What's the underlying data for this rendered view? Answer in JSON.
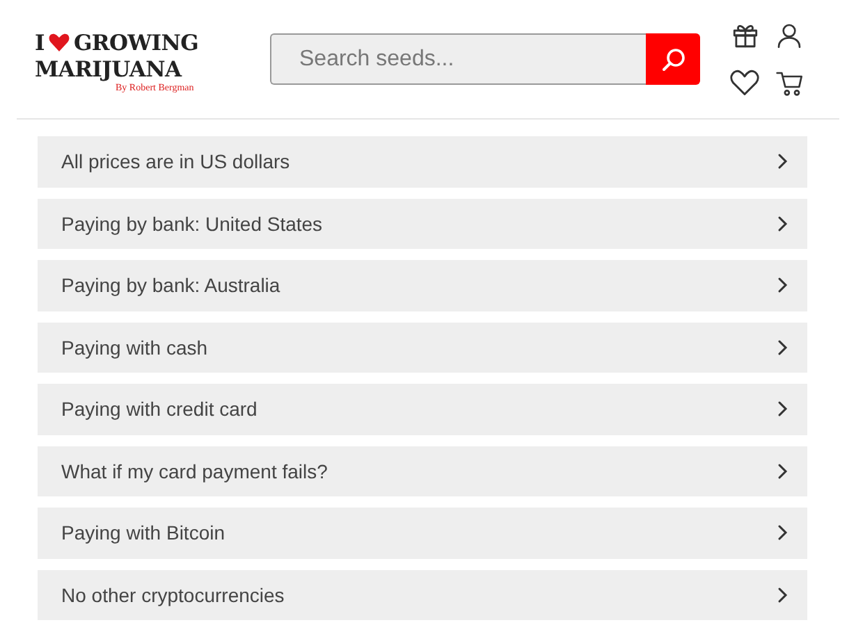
{
  "logo": {
    "line_1_start": "I",
    "line_1_end": "GROWING",
    "line_2": "MARIJUANA",
    "byline": "By Robert Bergman"
  },
  "search": {
    "placeholder": "Search seeds..."
  },
  "faq_items": [
    {
      "label": "All prices are in US dollars",
      "expanded": false
    },
    {
      "label": "Paying by bank: United States",
      "expanded": false
    },
    {
      "label": "Paying by bank: Australia",
      "expanded": false
    },
    {
      "label": "Paying with cash",
      "expanded": false
    },
    {
      "label": "Paying with credit card",
      "expanded": false
    },
    {
      "label": "What if my card payment fails?",
      "expanded": false
    },
    {
      "label": "Paying with Bitcoin",
      "expanded": false
    },
    {
      "label": "No other cryptocurrencies",
      "expanded": false
    }
  ]
}
